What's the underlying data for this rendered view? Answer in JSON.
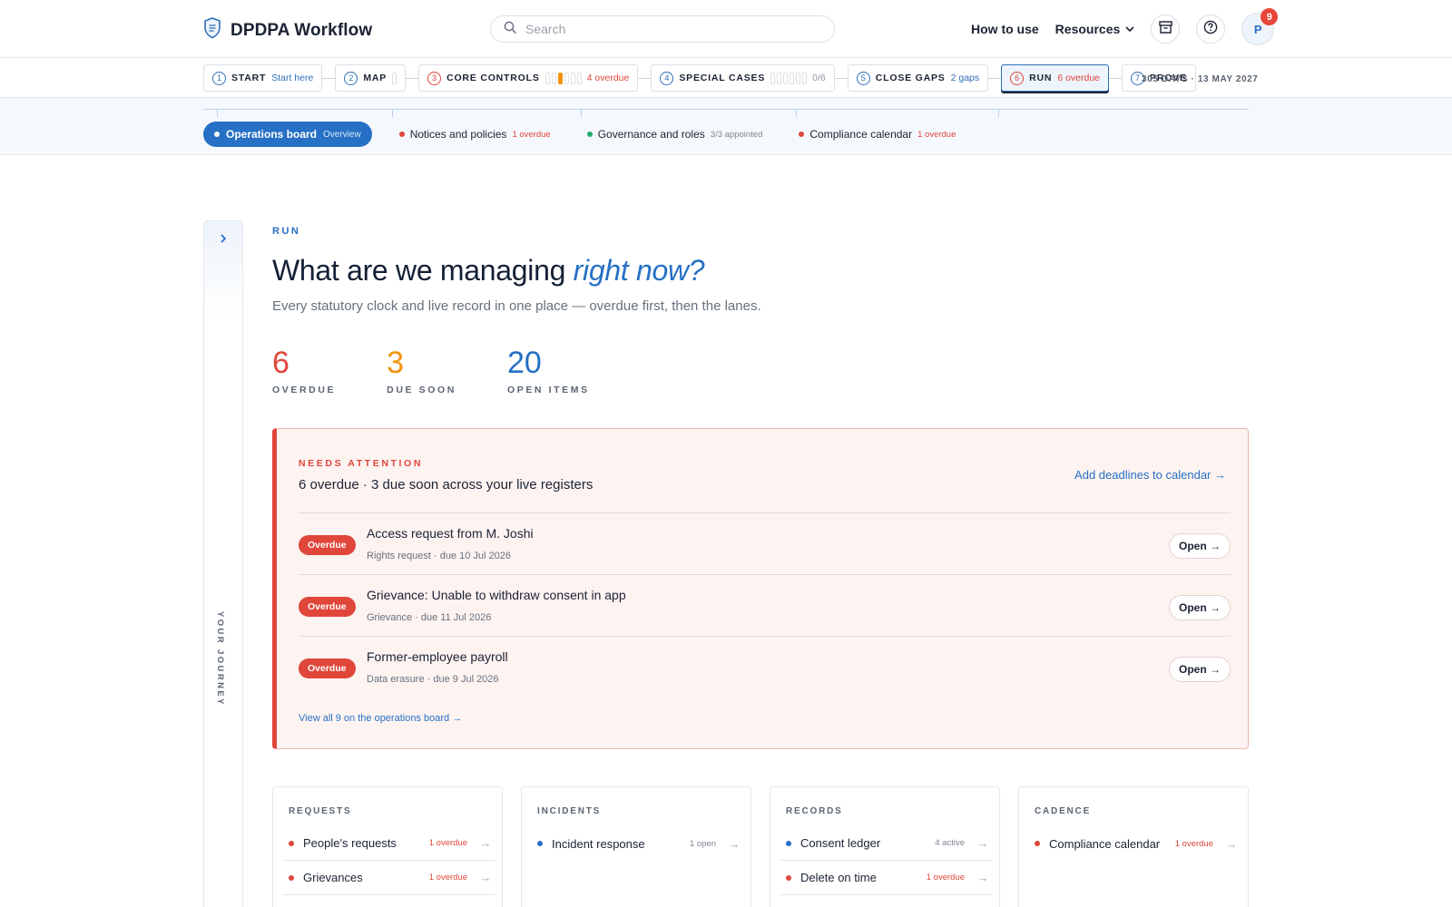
{
  "header": {
    "app_title": "DPDPA Workflow",
    "search_placeholder": "Search",
    "how_to_use": "How to use",
    "resources": "Resources",
    "avatar_initial": "P",
    "notification_count": "9"
  },
  "steps": [
    {
      "num": "1",
      "label": "START",
      "sub": "Start here"
    },
    {
      "num": "2",
      "label": "MAP",
      "sub": ""
    },
    {
      "num": "3",
      "label": "CORE CONTROLS",
      "sub": "4 overdue"
    },
    {
      "num": "4",
      "label": "SPECIAL CASES",
      "sub": "0/6"
    },
    {
      "num": "5",
      "label": "CLOSE GAPS",
      "sub": "2 gaps"
    },
    {
      "num": "6",
      "label": "RUN",
      "sub": "6 overdue"
    },
    {
      "num": "7",
      "label": "PROVE",
      "sub": ""
    }
  ],
  "countdown": "305 DAYS · 13 MAY 2027",
  "subnav": [
    {
      "label": "Operations board",
      "note": "Overview"
    },
    {
      "label": "Notices and policies",
      "note": "1 overdue"
    },
    {
      "label": "Governance and roles",
      "note": "3/3 appointed"
    },
    {
      "label": "Compliance calendar",
      "note": "1 overdue"
    }
  ],
  "rail_label": "YOUR JOURNEY",
  "main": {
    "eyebrow": "RUN",
    "headline_plain": "What are we managing ",
    "headline_accent": "right now?",
    "subline": "Every statutory clock and live record in one place — overdue first, then the lanes."
  },
  "stats": [
    {
      "value": "6",
      "label": "OVERDUE"
    },
    {
      "value": "3",
      "label": "DUE SOON"
    },
    {
      "value": "20",
      "label": "OPEN ITEMS"
    }
  ],
  "attention": {
    "eyebrow": "NEEDS ATTENTION",
    "title": "6 overdue · 3 due soon across your live registers",
    "calendar_link": "Add deadlines to calendar →",
    "rows": [
      {
        "badge": "Overdue",
        "title": "Access request from M. Joshi",
        "meta": "Rights request · due 10 Jul 2026",
        "action": "Open →"
      },
      {
        "badge": "Overdue",
        "title": "Grievance: Unable to withdraw consent in app",
        "meta": "Grievance · due 11 Jul 2026",
        "action": "Open →"
      },
      {
        "badge": "Overdue",
        "title": "Former-employee payroll",
        "meta": "Data erasure · due 9 Jul 2026",
        "action": "Open →"
      }
    ],
    "view_all": "View all 9 on the operations board →"
  },
  "cards": [
    {
      "title": "REQUESTS",
      "items": [
        {
          "label": "People's requests",
          "note": "1 overdue"
        },
        {
          "label": "Grievances",
          "note": "1 overdue"
        }
      ]
    },
    {
      "title": "INCIDENTS",
      "items": [
        {
          "label": "Incident response",
          "note": "1 open"
        }
      ]
    },
    {
      "title": "RECORDS",
      "items": [
        {
          "label": "Consent ledger",
          "note": "4 active"
        },
        {
          "label": "Delete on time",
          "note": "1 overdue"
        }
      ]
    },
    {
      "title": "CADENCE",
      "items": [
        {
          "label": "Compliance calendar",
          "note": "1 overdue"
        }
      ]
    }
  ],
  "colors": {
    "accent_blue": "#2670c5",
    "overdue_red": "#e0463a",
    "due_soon_amber": "#f2930d",
    "ok_green": "#27a96c",
    "ink": "#1b2233"
  }
}
